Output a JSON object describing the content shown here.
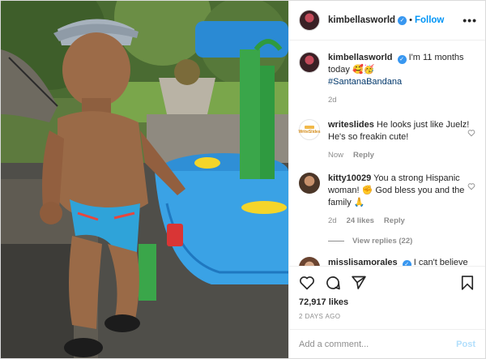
{
  "header": {
    "username": "kimbellasworld",
    "separator": "•",
    "follow_label": "Follow",
    "more_label": "•••"
  },
  "caption": {
    "username": "kimbellasworld",
    "text": "I'm 11 months today 🥰🥳",
    "hashtag": "#SantanaBandana",
    "time": "2d"
  },
  "comments": [
    {
      "username": "writeslides",
      "avatar_text": "WriteSlides",
      "text": "He looks just like Juelz! He's so freakin cute!",
      "time": "Now",
      "reply_label": "Reply"
    },
    {
      "username": "kitty10029",
      "text": "You a strong Hispanic woman! ✊ God bless you and the family 🙏",
      "time": "2d",
      "likes": "24 likes",
      "reply_label": "Reply",
      "view_replies": "View replies (22)"
    },
    {
      "username": "misslisamorales",
      "text": "I can't believe it !"
    }
  ],
  "footer": {
    "likes": "72,917 likes",
    "ago": "2 DAYS AGO",
    "comment_placeholder": "Add a comment...",
    "post_label": "Post"
  },
  "icons": [
    "heart-icon",
    "comment-icon",
    "share-icon",
    "save-icon",
    "verified-icon",
    "more-icon"
  ],
  "colors": {
    "follow": "#0095f6",
    "hashtag": "#00376b",
    "verified": "#3897f0",
    "post_disabled": "#b2dffc",
    "muted": "#8e8e8e"
  }
}
